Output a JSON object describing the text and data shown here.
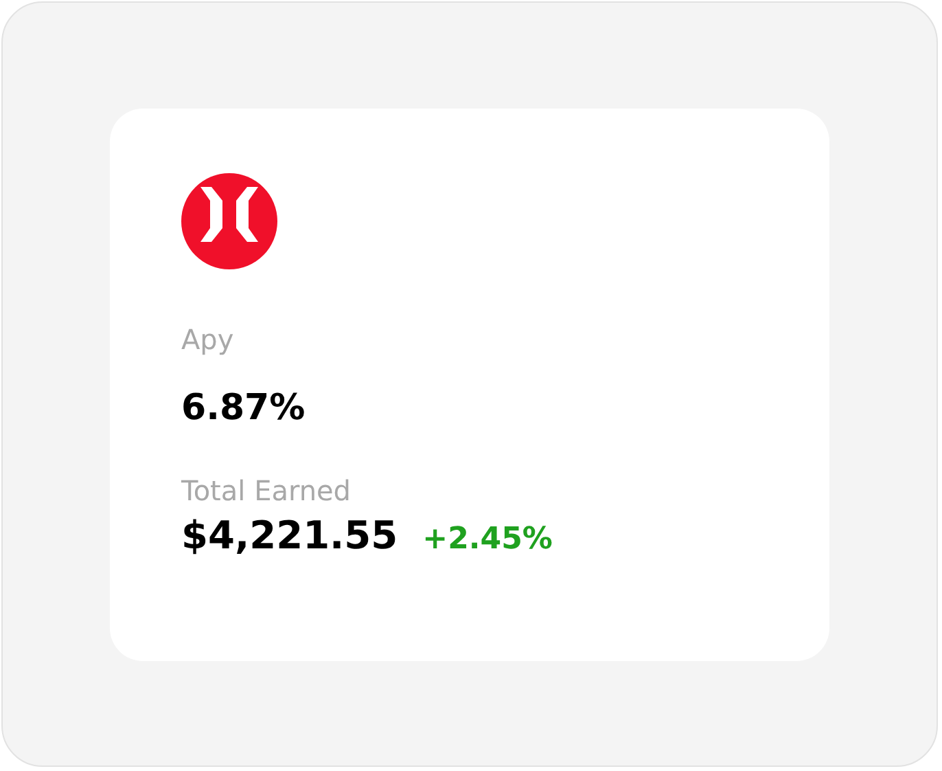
{
  "card": {
    "apy_label": "Apy",
    "apy_value": "6.87%",
    "earned_label": "Total Earned",
    "earned_value": "$4,221.55",
    "change": "+2.45%"
  }
}
